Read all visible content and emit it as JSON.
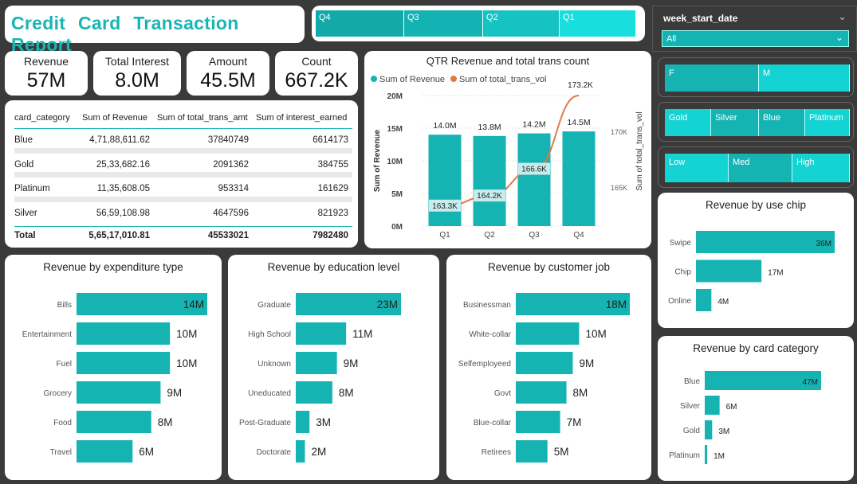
{
  "title": "Credit  Card   Transaction  Report",
  "quarter_slicer": [
    "Q4",
    "Q3",
    "Q2",
    "Q1"
  ],
  "week_slicer": {
    "label": "week_start_date",
    "value": "All"
  },
  "kpis": [
    {
      "label": "Revenue",
      "value": "57M"
    },
    {
      "label": "Total Interest",
      "value": "8.0M"
    },
    {
      "label": "Amount",
      "value": "45.5M"
    },
    {
      "label": "Count",
      "value": "667.2K"
    }
  ],
  "table": {
    "headers": [
      "card_category",
      "Sum of Revenue",
      "Sum of total_trans_amt",
      "Sum of interest_earned"
    ],
    "rows": [
      [
        "Blue",
        "4,71,88,611.62",
        "37840749",
        "6614173"
      ],
      [
        "Gold",
        "25,33,682.16",
        "2091362",
        "384755"
      ],
      [
        "Platinum",
        "11,35,608.05",
        "953314",
        "161629"
      ],
      [
        "Silver",
        "56,59,108.98",
        "4647596",
        "821923"
      ]
    ],
    "total": [
      "Total",
      "5,65,17,010.81",
      "45533021",
      "7982480"
    ]
  },
  "gender_slicer": [
    "F",
    "M"
  ],
  "card_slicer": [
    "Gold",
    "Silver",
    "Blue",
    "Platinum"
  ],
  "income_slicer": [
    "Low",
    "Med",
    "High"
  ],
  "colors": {
    "teal": "#16b3b3",
    "orange": "#e07a45",
    "label_bg": "#c8ecec"
  },
  "chart_data": [
    {
      "type": "bar",
      "title": "QTR Revenue and total trans count",
      "legend": [
        "Sum of Revenue",
        "Sum of total_trans_vol"
      ],
      "categories": [
        "Q1",
        "Q2",
        "Q3",
        "Q4"
      ],
      "series": [
        {
          "name": "Sum of Revenue",
          "values": [
            14.0,
            13.8,
            14.2,
            14.5
          ],
          "labels": [
            "14.0M",
            "13.8M",
            "14.2M",
            "14.5M"
          ]
        },
        {
          "name": "Sum of total_trans_vol",
          "values": [
            163.3,
            164.2,
            166.6,
            173.2
          ],
          "labels": [
            "163.3K",
            "164.2K",
            "166.6K",
            "173.2K"
          ]
        }
      ],
      "ylabel": "Sum of Revenue",
      "y2label": "Sum of total_trans_vol",
      "yticks": [
        "0M",
        "5M",
        "10M",
        "15M",
        "20M"
      ],
      "y2ticks": [
        "165K",
        "170K"
      ],
      "ylim": [
        0,
        20
      ],
      "y2lim": [
        161.5,
        173.2
      ]
    },
    {
      "type": "bar",
      "title": "Revenue by use chip",
      "categories": [
        "Swipe",
        "Chip",
        "Online"
      ],
      "values": [
        36,
        17,
        4
      ],
      "labels": [
        "36M",
        "17M",
        "4M"
      ]
    },
    {
      "type": "bar",
      "title": "Revenue by expenditure type",
      "categories": [
        "Bills",
        "Entertainment",
        "Fuel",
        "Grocery",
        "Food",
        "Travel"
      ],
      "values": [
        14,
        10,
        10,
        9,
        8,
        6
      ],
      "labels": [
        "14M",
        "10M",
        "10M",
        "9M",
        "8M",
        "6M"
      ]
    },
    {
      "type": "bar",
      "title": "Revenue by education level",
      "categories": [
        "Graduate",
        "High School",
        "Unknown",
        "Uneducated",
        "Post-Graduate",
        "Doctorate"
      ],
      "values": [
        23,
        11,
        9,
        8,
        3,
        2
      ],
      "labels": [
        "23M",
        "11M",
        "9M",
        "8M",
        "3M",
        "2M"
      ]
    },
    {
      "type": "bar",
      "title": "Revenue by customer job",
      "categories": [
        "Businessman",
        "White-collar",
        "Selfemployeed",
        "Govt",
        "Blue-collar",
        "Retirees"
      ],
      "values": [
        18,
        10,
        9,
        8,
        7,
        5
      ],
      "labels": [
        "18M",
        "10M",
        "9M",
        "8M",
        "7M",
        "5M"
      ]
    },
    {
      "type": "bar",
      "title": "Revenue by card category",
      "categories": [
        "Blue",
        "Silver",
        "Gold",
        "Platinum"
      ],
      "values": [
        47,
        6,
        3,
        1
      ],
      "labels": [
        "47M",
        "6M",
        "3M",
        "1M"
      ]
    }
  ]
}
